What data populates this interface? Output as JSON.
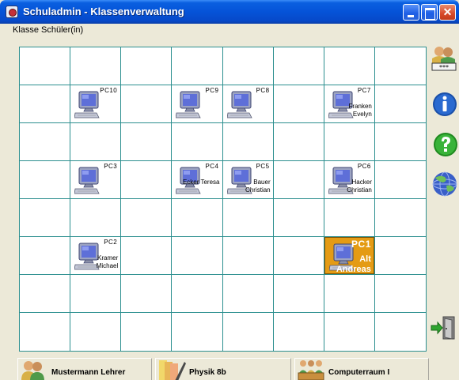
{
  "window": {
    "title": "Schuladmin - Klassenverwaltung",
    "minimize_icon": "minimize-icon",
    "maximize_icon": "maximize-icon",
    "close_icon": "close-icon"
  },
  "menu": {
    "items": [
      "Klasse",
      "Schüler(in)"
    ]
  },
  "grid": {
    "columns": 8,
    "rows": 8,
    "line_color": "#2c8f8f",
    "selected_color": "#e49b14"
  },
  "pcs": [
    {
      "label": "PC10",
      "row": 1,
      "col": 1,
      "user": []
    },
    {
      "label": "PC9",
      "row": 1,
      "col": 3,
      "user": []
    },
    {
      "label": "PC8",
      "row": 1,
      "col": 4,
      "user": []
    },
    {
      "label": "PC7",
      "row": 1,
      "col": 6,
      "user": [
        "Franken",
        "Evelyn"
      ]
    },
    {
      "label": "PC3",
      "row": 3,
      "col": 1,
      "user": []
    },
    {
      "label": "PC4",
      "row": 3,
      "col": 3,
      "user": [
        "Ecker Teresa"
      ]
    },
    {
      "label": "PC5",
      "row": 3,
      "col": 4,
      "user": [
        "Bauer",
        "Christian"
      ]
    },
    {
      "label": "PC6",
      "row": 3,
      "col": 6,
      "user": [
        "Hacker",
        "Christian"
      ]
    },
    {
      "label": "PC2",
      "row": 5,
      "col": 1,
      "user": [
        "Kramer",
        "Michael"
      ]
    },
    {
      "label": "PC1",
      "row": 5,
      "col": 6,
      "user": [
        "Alt",
        "Andreas"
      ],
      "selected": true
    }
  ],
  "toolbar": {
    "icons": [
      "users-password-icon",
      "info-icon",
      "help-icon",
      "globe-icon",
      "logout-door-icon"
    ]
  },
  "status": {
    "teacher": "Mustermann Lehrer",
    "class": "Physik 8b",
    "room": "Computerraum I"
  }
}
